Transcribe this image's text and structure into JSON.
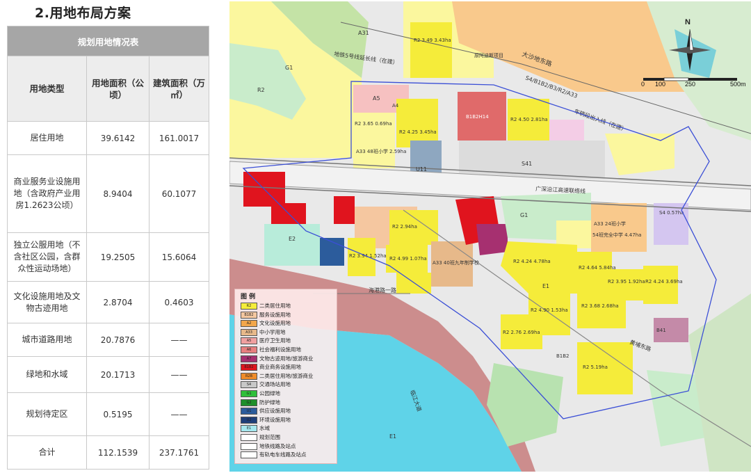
{
  "page": {
    "section_title": "2.用地布局方案"
  },
  "table": {
    "caption": "规划用地情况表",
    "headers": [
      "用地类型",
      "用地面积（公顷）",
      "建筑面积（万㎡）"
    ],
    "rows": [
      {
        "type": "居住用地",
        "area": "39.6142",
        "floor_area": "161.0017"
      },
      {
        "type": "商业服务业设施用地（含政府产业用房1.2623公顷）",
        "area": "8.9404",
        "floor_area": "60.1077"
      },
      {
        "type": "独立公服用地（不含社区公园，含群众性运动场地）",
        "area": "19.2505",
        "floor_area": "15.6064"
      },
      {
        "type": "文化设施用地及文物古迹用地",
        "area": "2.8704",
        "floor_area": "0.4603"
      },
      {
        "type": "城市道路用地",
        "area": "20.7876",
        "floor_area": "——"
      },
      {
        "type": "绿地和水域",
        "area": "20.1713",
        "floor_area": "——"
      },
      {
        "type": "规划待定区",
        "area": "0.5195",
        "floor_area": "——"
      },
      {
        "type": "合计",
        "area": "112.1539",
        "floor_area": "237.1761"
      }
    ]
  },
  "map": {
    "north_label": "N",
    "scale_labels": [
      "0",
      "100",
      "250",
      "500m"
    ],
    "labels": {
      "road_dasha": "大沙地东路",
      "road_metro5": "地铁5号线延长线（在建）",
      "road_hsr": "S4/B1B2/B3/R2/A33",
      "road_depot": "车辆段出入线（在建）",
      "road_gaosu": "广深沿江高速联络线",
      "road_huangpu": "黄埔东路",
      "road_linjiang": "临江大道",
      "road_haidong": "海港路一路",
      "project_old": "原阿迪斯项目",
      "parcel_a31": "A31",
      "parcel_g1": "G1",
      "parcel_r2": "R2",
      "parcel_a5": "A5",
      "parcel_a4": "A4",
      "parcel_b1b2h14": "B1B2H14",
      "parcel_s41": "S41",
      "parcel_u11": "U11",
      "parcel_e1": "E1",
      "parcel_e2": "E2",
      "parcel_a33": "A33",
      "parcel_b41": "B41",
      "parcel_b1b2": "B1B2",
      "parcel_r2_349": "R2 3.49 3.43ha",
      "parcel_school": "A33 48班小学 2.59ha",
      "parcel_school2": "A33 24班小学",
      "parcel_school3": "54班完全中学 4.47ha",
      "parcel_r2_484": "R2 4.24 4.78ha",
      "parcel_r2_490": "R2 4.90 1.53ha",
      "parcel_r2_519": "R2 5.19ha",
      "parcel_r2_281": "R2 4.50 2.81ha",
      "parcel_r2_345": "R2 3.65 0.69ha",
      "parcel_r2_425": "R2 4.25 3.45ha",
      "parcel_r2_294": "R2 2.94ha",
      "parcel_r2_499": "R2 4.99 1.07ha",
      "parcel_r2_394": "R2 3.94 1.52ha",
      "parcel_r2_395": "R2 3.95 1.92ha",
      "parcel_r2_368": "R2 3.68 2.68ha",
      "parcel_r2_424b": "R2 4.24 3.69ha",
      "parcel_r2_276": "R2 2.76 2.69ha",
      "parcel_r2_464": "R2 4.64 5.84ha",
      "parcel_a33_9": "A33 40班九年制学校",
      "parcel_s4": "S4 0.57ha"
    },
    "legend": {
      "title": "图  例",
      "items": [
        {
          "code": "R2",
          "label": "二类居住用地",
          "color": "#f5ec3a"
        },
        {
          "code": "B1B2",
          "label": "服务设施用地",
          "color": "#f5c7a0"
        },
        {
          "code": "A2",
          "label": "文化设施用地",
          "color": "#f2a74b"
        },
        {
          "code": "A33",
          "label": "中小学用地",
          "color": "#e7b98a"
        },
        {
          "code": "A5",
          "label": "医疗卫生用地",
          "color": "#f0a0a0"
        },
        {
          "code": "A6",
          "label": "社会福利设施用地",
          "color": "#e77f7f"
        },
        {
          "code": "A7",
          "label": "文物古迹用地/旅游商业",
          "color": "#a63070"
        },
        {
          "code": "B1B2",
          "label": "商业商务设施用地",
          "color": "#e0141e"
        },
        {
          "code": "R2B",
          "label": "二类居住用地/旅游商业",
          "color": "#f08c2a"
        },
        {
          "code": "S4",
          "label": "交通场站用地",
          "color": "#c8c8c8"
        },
        {
          "code": "G1",
          "label": "公园绿地",
          "color": "#2fbf3a"
        },
        {
          "code": "G2",
          "label": "防护绿地",
          "color": "#1e8f2a"
        },
        {
          "code": "U1",
          "label": "供应设施用地",
          "color": "#2c5c9c"
        },
        {
          "code": "U2",
          "label": "环境设施用地",
          "color": "#1f3f7a"
        },
        {
          "code": "E1",
          "label": "水域",
          "color": "#a6e8ef"
        },
        {
          "code": "",
          "label": "规划范围",
          "color": "#ffffff"
        },
        {
          "code": "",
          "label": "地铁线路及站点",
          "color": "#ffffff"
        },
        {
          "code": "",
          "label": "有轨电车线路及站点",
          "color": "#ffffff"
        }
      ]
    }
  }
}
